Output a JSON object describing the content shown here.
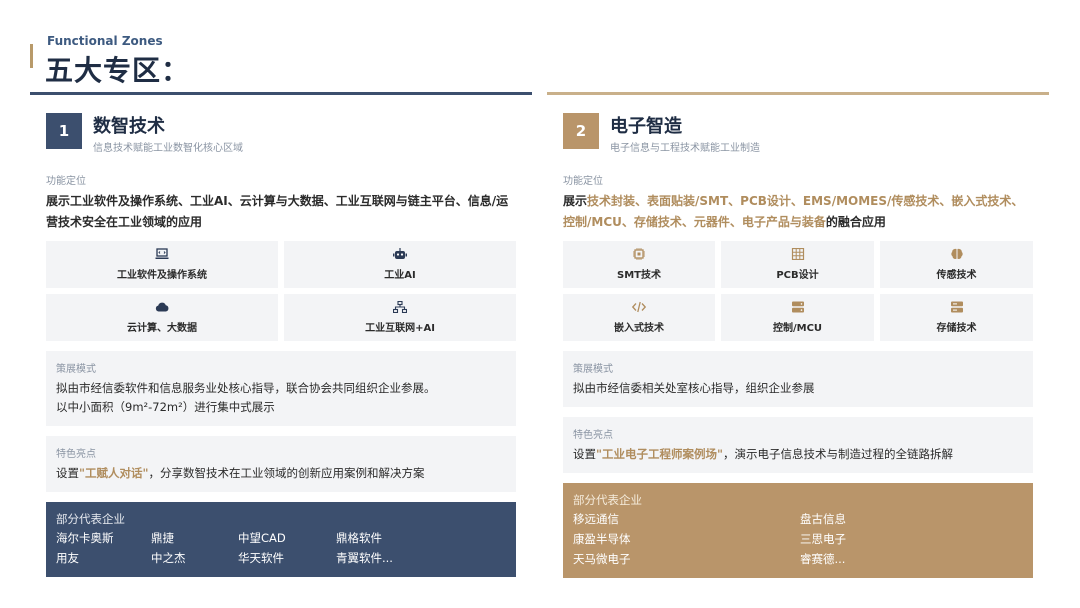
{
  "header": {
    "subtitle": "Functional Zones",
    "title": "五大专区："
  },
  "zones": [
    {
      "number": "1",
      "title": "数智技术",
      "subtitle": "信息技术赋能工业数智化核心区域",
      "positioning_label": "功能定位",
      "positioning_text": "展示工业软件及操作系统、工业AI、云计算与大数据、工业互联网与链主平台、信息/运营技术安全在工业领域的应用",
      "tiles": [
        {
          "icon": "laptop-code-icon",
          "label": "工业软件及操作系统"
        },
        {
          "icon": "robot-icon",
          "label": "工业AI"
        },
        {
          "icon": "cloud-icon",
          "label": "云计算、大数据"
        },
        {
          "icon": "network-icon",
          "label": "工业互联网+AI"
        }
      ],
      "mode_label": "策展模式",
      "mode_line1": "拟由市经信委软件和信息服务业处核心指导，联合协会共同组织企业参展。",
      "mode_line2": "以中小面积（9m²-72m²）进行集中式展示",
      "feature_label": "特色亮点",
      "feature_pre": "设置",
      "feature_hl": "\"工赋人对话\"",
      "feature_post": "，分享数智技术在工业领域的创新应用案例和解决方案",
      "companies_label": "部分代表企业",
      "companies": [
        "海尔卡奥斯",
        "鼎捷",
        "中望CAD",
        "鼎格软件",
        "用友",
        "中之杰",
        "华天软件",
        "青翼软件..."
      ]
    },
    {
      "number": "2",
      "title": "电子智造",
      "subtitle": "电子信息与工程技术赋能工业制造",
      "positioning_label": "功能定位",
      "positioning_pre": "展示",
      "positioning_hl": "技术封装、表面贴装/SMT、PCB设计、EMS/MOMES/传感技术、嵌入式技术、控制/MCU、存储技术、元器件、电子产品与装备",
      "positioning_post": "的融合应用",
      "tiles": [
        {
          "icon": "chip-icon",
          "label": "SMT技术"
        },
        {
          "icon": "grid-board-icon",
          "label": "PCB设计"
        },
        {
          "icon": "brain-icon",
          "label": "传感技术"
        },
        {
          "icon": "code-icon",
          "label": "嵌入式技术"
        },
        {
          "icon": "server-icon",
          "label": "控制/MCU"
        },
        {
          "icon": "storage-icon",
          "label": "存储技术"
        }
      ],
      "mode_label": "策展模式",
      "mode_line1": "拟由市经信委相关处室核心指导，组织企业参展",
      "feature_label": "特色亮点",
      "feature_pre": "设置",
      "feature_hl": "\"工业电子工程师案例场\"",
      "feature_post": "，演示电子信息技术与制造过程的全链路拆解",
      "companies_label": "部分代表企业",
      "companies": [
        "移远通信",
        "盘古信息",
        "康盈半导体",
        "三思电子",
        "天马微电子",
        "睿赛德..."
      ]
    }
  ],
  "colors": {
    "navy": "#3c4f6e",
    "gold": "#b9956a",
    "highlight": "#b08d5e",
    "tile_bg": "#f3f4f6"
  }
}
